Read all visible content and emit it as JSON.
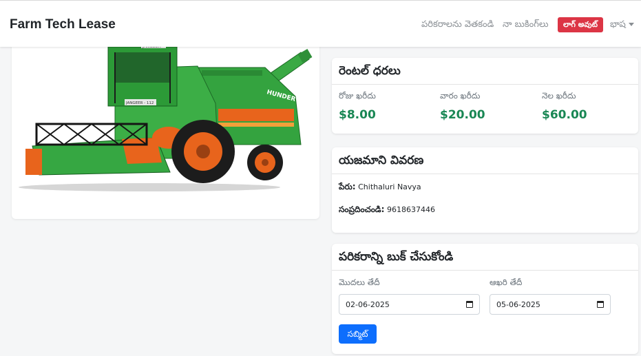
{
  "navbar": {
    "brand": "Farm Tech Lease",
    "browse_label": "పరికరాలను వెతకండి",
    "bookings_label": "నా బుకింగ్‌లు",
    "logout_label": "లాగ్ అవుట్",
    "language_label": "భాష"
  },
  "equipment_image": {
    "icon": "combine-harvester-image",
    "label_plate_1": "JANGEER",
    "label_plate_2": "JANGEER - 112",
    "brand_decal": "HUNDER",
    "body_color": "#2e9e3a",
    "accent_color": "#e8641c"
  },
  "rental": {
    "title": "రెంటల్ ధరలు",
    "daily_label": "రోజు ఖరీదు",
    "daily_value": "$8.00",
    "weekly_label": "వారం ఖరీదు",
    "weekly_value": "$20.00",
    "monthly_label": "నెల ఖరీదు",
    "monthly_value": "$60.00"
  },
  "owner": {
    "title": "యజమాని వివరణ",
    "name_label": "పేరు:",
    "name_value": "Chithaluri Navya",
    "contact_label": "సంప్రదించండి:",
    "contact_value": "9618637446"
  },
  "booking": {
    "title": "పరికరాన్ని బుక్ చేసుకోండి",
    "start_label": "మొదలు తేదీ",
    "start_value": "02-06-2025",
    "end_label": "ఆఖరి తేదీ",
    "end_value": "05-06-2025",
    "submit_label": "సబ్మిట్"
  },
  "colors": {
    "primary": "#0d6efd",
    "danger": "#dc3545",
    "price_green": "#198754"
  }
}
